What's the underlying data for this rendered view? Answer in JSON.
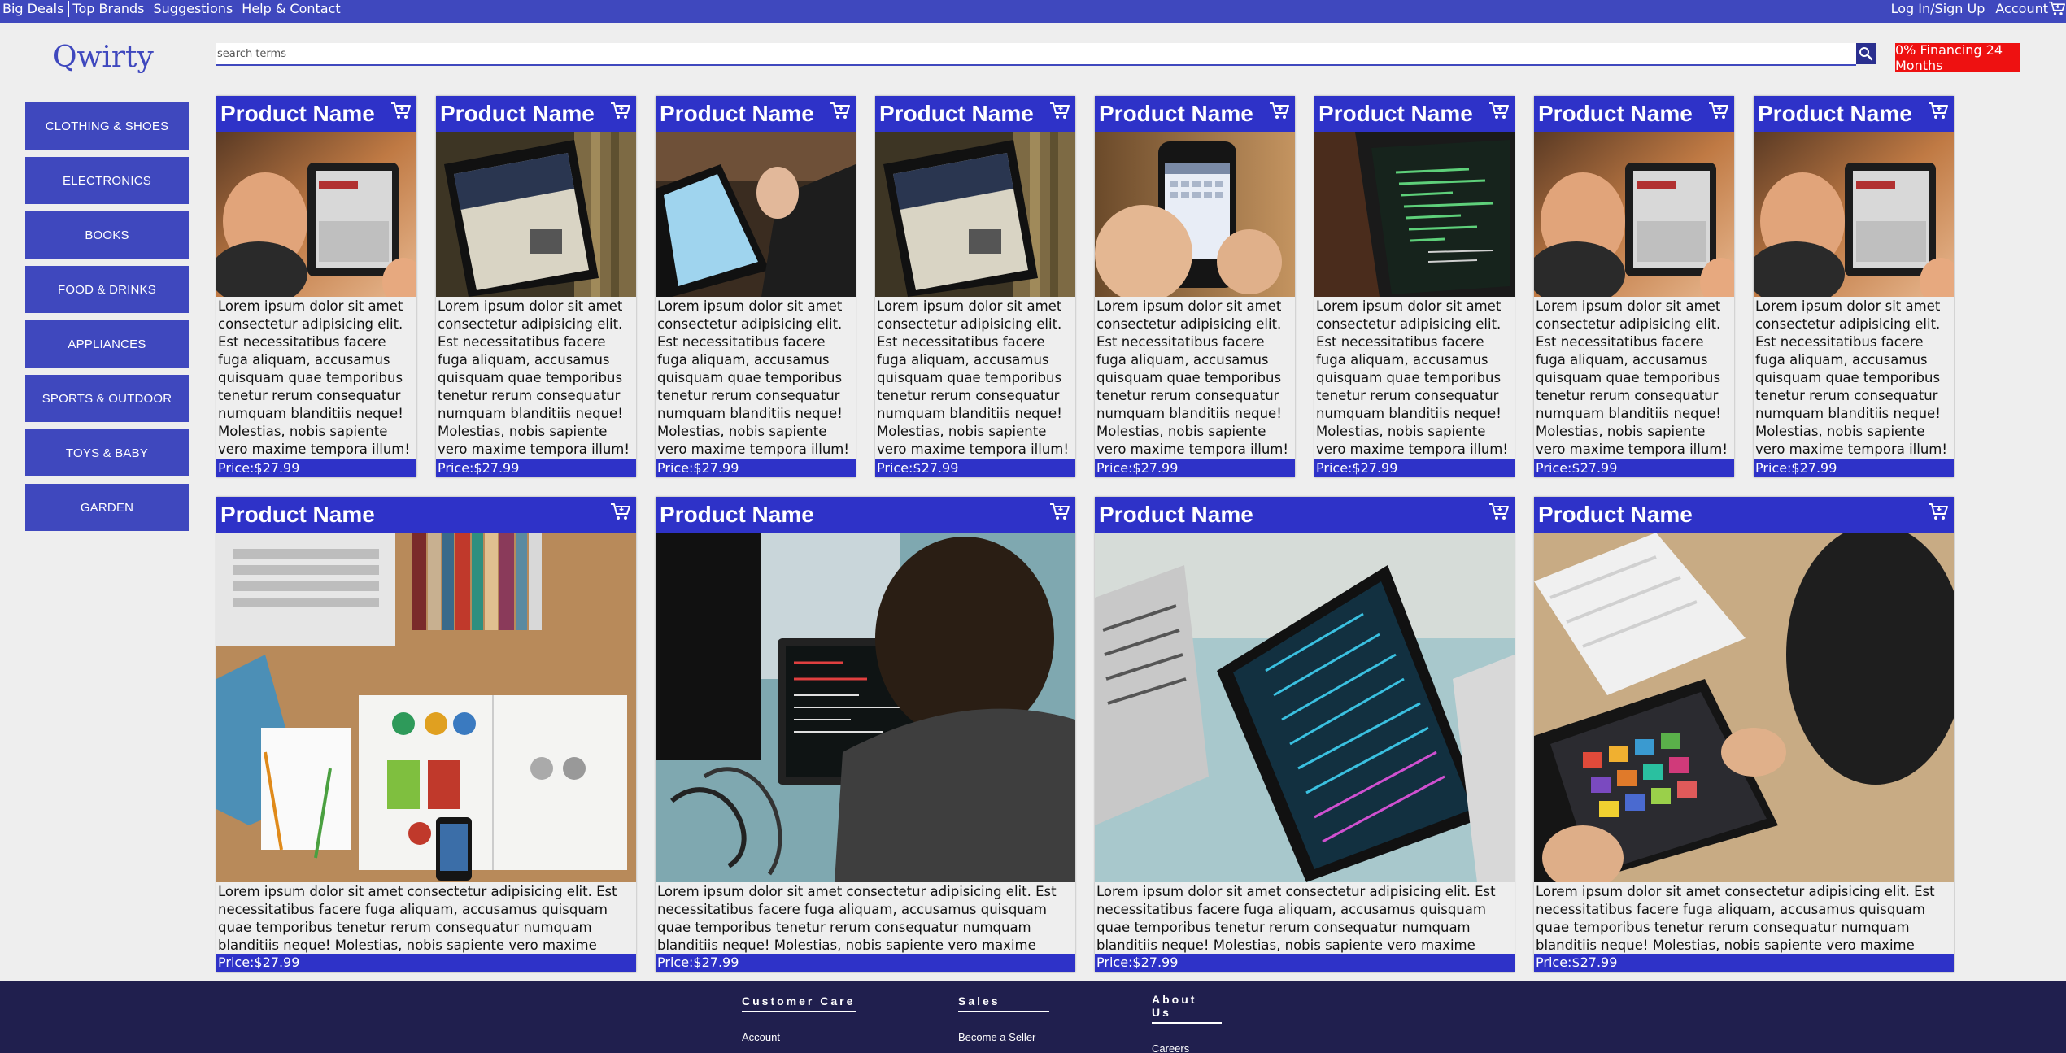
{
  "topbar": {
    "left_links": [
      "Big Deals",
      "Top Brands",
      "Suggestions",
      "Help & Contact"
    ],
    "login": "Log In/Sign Up",
    "account": "Account"
  },
  "logo": "Qwirty",
  "search": {
    "placeholder": "search terms"
  },
  "financing": "0% Financing 24 Months",
  "categories": [
    "CLOTHING & SHOES",
    "ELECTRONICS",
    "BOOKS",
    "FOOD & DRINKS",
    "APPLIANCES",
    "SPORTS & OUTDOOR",
    "TOYS & BABY",
    "GARDEN"
  ],
  "products_row1": [
    {
      "name": "Product Name",
      "desc": "Lorem ipsum dolor sit amet consectetur adipisicing elit. Est necessitatibus facere fuga aliquam, accusamus quisquam quae temporibus tenetur rerum consequatur numquam blanditiis neque! Molestias, nobis sapiente vero maxime tempora illum!",
      "price": "Price:$27.99"
    },
    {
      "name": "Product Name",
      "desc": "Lorem ipsum dolor sit amet consectetur adipisicing elit. Est necessitatibus facere fuga aliquam, accusamus quisquam quae temporibus tenetur rerum consequatur numquam blanditiis neque! Molestias, nobis sapiente vero maxime tempora illum!",
      "price": "Price:$27.99"
    },
    {
      "name": "Product Name",
      "desc": "Lorem ipsum dolor sit amet consectetur adipisicing elit. Est necessitatibus facere fuga aliquam, accusamus quisquam quae temporibus tenetur rerum consequatur numquam blanditiis neque! Molestias, nobis sapiente vero maxime tempora illum!",
      "price": "Price:$27.99"
    },
    {
      "name": "Product Name",
      "desc": "Lorem ipsum dolor sit amet consectetur adipisicing elit. Est necessitatibus facere fuga aliquam, accusamus quisquam quae temporibus tenetur rerum consequatur numquam blanditiis neque! Molestias, nobis sapiente vero maxime tempora illum!",
      "price": "Price:$27.99"
    },
    {
      "name": "Product Name",
      "desc": "Lorem ipsum dolor sit amet consectetur adipisicing elit. Est necessitatibus facere fuga aliquam, accusamus quisquam quae temporibus tenetur rerum consequatur numquam blanditiis neque! Molestias, nobis sapiente vero maxime tempora illum!",
      "price": "Price:$27.99"
    },
    {
      "name": "Product Name",
      "desc": "Lorem ipsum dolor sit amet consectetur adipisicing elit. Est necessitatibus facere fuga aliquam, accusamus quisquam quae temporibus tenetur rerum consequatur numquam blanditiis neque! Molestias, nobis sapiente vero maxime tempora illum!",
      "price": "Price:$27.99"
    },
    {
      "name": "Product Name",
      "desc": "Lorem ipsum dolor sit amet consectetur adipisicing elit. Est necessitatibus facere fuga aliquam, accusamus quisquam quae temporibus tenetur rerum consequatur numquam blanditiis neque! Molestias, nobis sapiente vero maxime tempora illum!",
      "price": "Price:$27.99"
    },
    {
      "name": "Product Name",
      "desc": "Lorem ipsum dolor sit amet consectetur adipisicing elit. Est necessitatibus facere fuga aliquam, accusamus quisquam quae temporibus tenetur rerum consequatur numquam blanditiis neque! Molestias, nobis sapiente vero maxime tempora illum!",
      "price": "Price:$27.99"
    }
  ],
  "products_row2": [
    {
      "name": "Product Name",
      "desc": "Lorem ipsum dolor sit amet consectetur adipisicing elit. Est necessitatibus facere fuga aliquam, accusamus quisquam quae temporibus tenetur rerum consequatur numquam blanditiis neque! Molestias, nobis sapiente vero maxime tempora illum!",
      "price": "Price:$27.99"
    },
    {
      "name": "Product Name",
      "desc": "Lorem ipsum dolor sit amet consectetur adipisicing elit. Est necessitatibus facere fuga aliquam, accusamus quisquam quae temporibus tenetur rerum consequatur numquam blanditiis neque! Molestias, nobis sapiente vero maxime tempora illum!",
      "price": "Price:$27.99"
    },
    {
      "name": "Product Name",
      "desc": "Lorem ipsum dolor sit amet consectetur adipisicing elit. Est necessitatibus facere fuga aliquam, accusamus quisquam quae temporibus tenetur rerum consequatur numquam blanditiis neque! Molestias, nobis sapiente vero maxime tempora illum!",
      "price": "Price:$27.99"
    },
    {
      "name": "Product Name",
      "desc": "Lorem ipsum dolor sit amet consectetur adipisicing elit. Est necessitatibus facere fuga aliquam, accusamus quisquam quae temporibus tenetur rerum consequatur numquam blanditiis neque! Molestias, nobis sapiente vero maxime tempora illum!",
      "price": "Price:$27.99"
    }
  ],
  "footer": {
    "columns": [
      {
        "heading": "Customer Care",
        "link": "Account"
      },
      {
        "heading": "Sales",
        "link": "Become a Seller"
      },
      {
        "heading": "About Us",
        "link": "Careers"
      }
    ]
  },
  "icons": {
    "search": "search-icon",
    "cart": "cart-icon"
  },
  "colors": {
    "brand": "#3f48be",
    "card_header": "#2e32c8",
    "financing": "#ee1111",
    "footer": "#201f4e"
  }
}
